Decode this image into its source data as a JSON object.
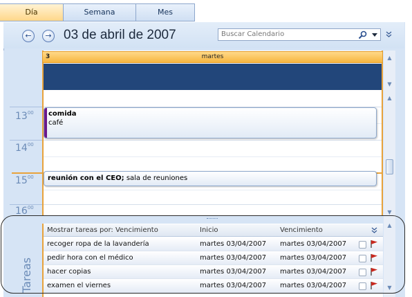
{
  "tabs": [
    {
      "label": "Día",
      "active": true
    },
    {
      "label": "Semana",
      "active": false
    },
    {
      "label": "Mes",
      "active": false
    }
  ],
  "header": {
    "date_title": "03 de abril de 2007",
    "search_placeholder": "Buscar Calendario"
  },
  "day": {
    "number": "3",
    "weekday": "martes"
  },
  "hours": [
    {
      "h": "13",
      "m": "00"
    },
    {
      "h": "14",
      "m": "00"
    },
    {
      "h": "15",
      "m": "00"
    },
    {
      "h": "16",
      "m": "00"
    }
  ],
  "events": [
    {
      "title": "comida",
      "location": "café"
    },
    {
      "title": "reunión con el CEO;",
      "location": "sala de reuniones"
    }
  ],
  "tasks": {
    "panel_label": "Tareas",
    "columns": {
      "show_by": "Mostrar tareas por: Vencimiento",
      "start": "Inicio",
      "due": "Vencimiento"
    },
    "rows": [
      {
        "name": "recoger ropa de la lavandería",
        "start": "martes 03/04/2007",
        "due": "martes 03/04/2007"
      },
      {
        "name": "pedir hora con el médico",
        "start": "martes 03/04/2007",
        "due": "martes 03/04/2007"
      },
      {
        "name": "hacer copias",
        "start": "martes 03/04/2007",
        "due": "martes 03/04/2007"
      },
      {
        "name": "examen el viernes",
        "start": "martes 03/04/2007",
        "due": "martes 03/04/2007"
      }
    ]
  },
  "colors": {
    "accent_orange": "#e8a23a",
    "allday_blue": "#22467a",
    "flag_red": "#c8281e"
  }
}
